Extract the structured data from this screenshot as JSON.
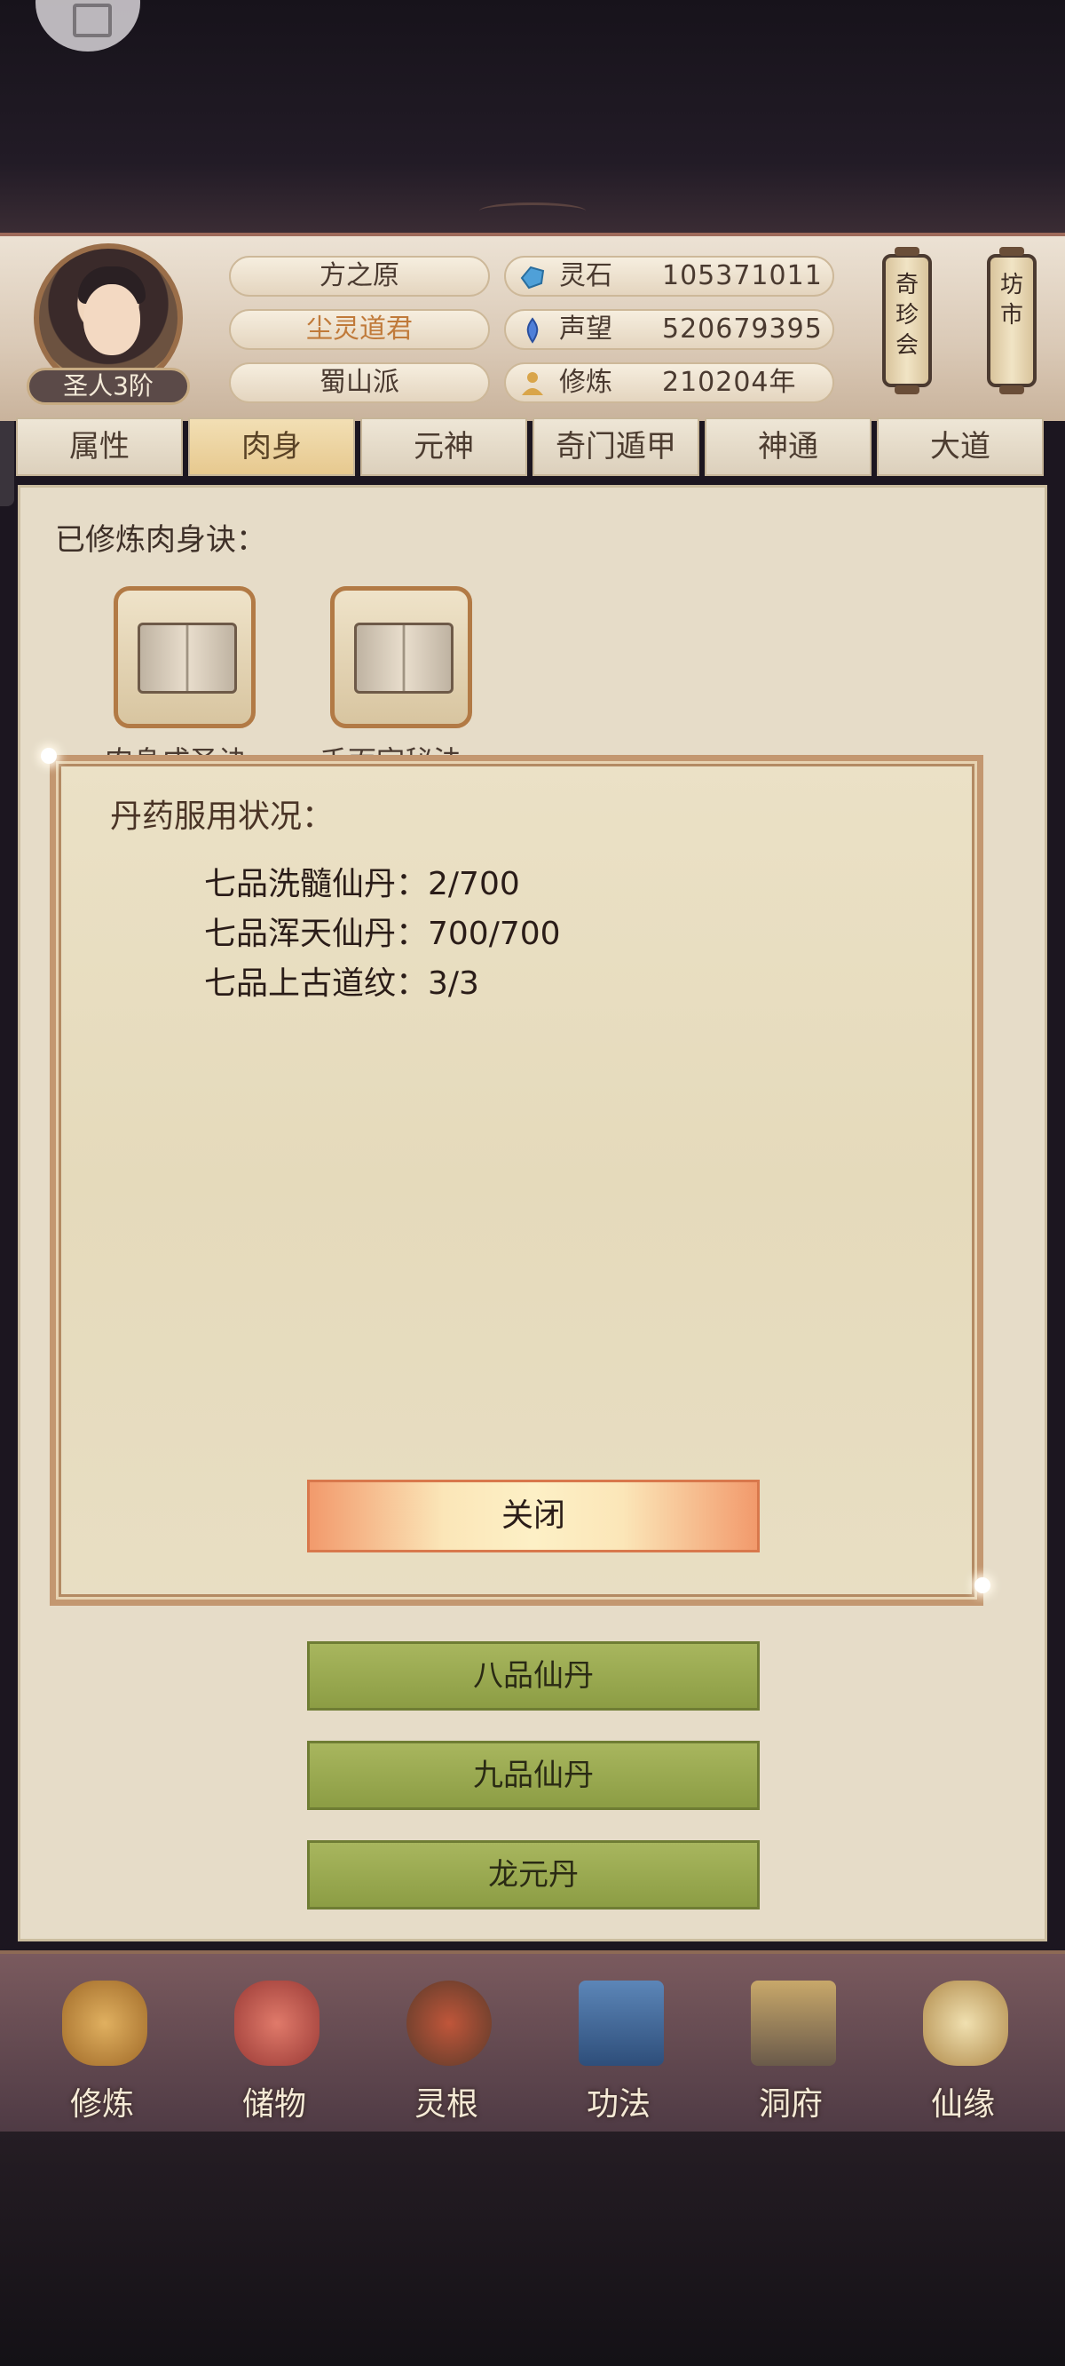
{
  "player": {
    "rank": "圣人3阶",
    "info": [
      "方之原",
      "尘灵道君",
      "蜀山派"
    ],
    "resources": [
      {
        "icon": "spirit-stone-icon",
        "label": "灵石",
        "value": "105371011"
      },
      {
        "icon": "reputation-icon",
        "label": "声望",
        "value": "520679395"
      },
      {
        "icon": "cultivation-icon",
        "label": "修炼",
        "value": "210204年"
      }
    ]
  },
  "side_buttons": [
    "奇珍会",
    "坊市"
  ],
  "tabs": [
    "属性",
    "肉身",
    "元神",
    "奇门遁甲",
    "神通",
    "大道"
  ],
  "active_tab": "肉身",
  "section": {
    "title": "已修炼肉身诀：",
    "books": [
      "肉身成圣诀",
      "千面宗秘法"
    ]
  },
  "pill_buttons": [
    "八品仙丹",
    "九品仙丹",
    "龙元丹"
  ],
  "modal": {
    "title": "丹药服用状况：",
    "lines": [
      "七品洗髓仙丹：2/700",
      "七品浑天仙丹：700/700",
      "七品上古道纹：3/3"
    ],
    "close_label": "关闭"
  },
  "nav": [
    "修炼",
    "储物",
    "灵根",
    "功法",
    "洞府",
    "仙缘"
  ],
  "colors": {
    "accent": "#c39770",
    "green_button": "#9aab50",
    "close_button": "#f29a6c"
  }
}
